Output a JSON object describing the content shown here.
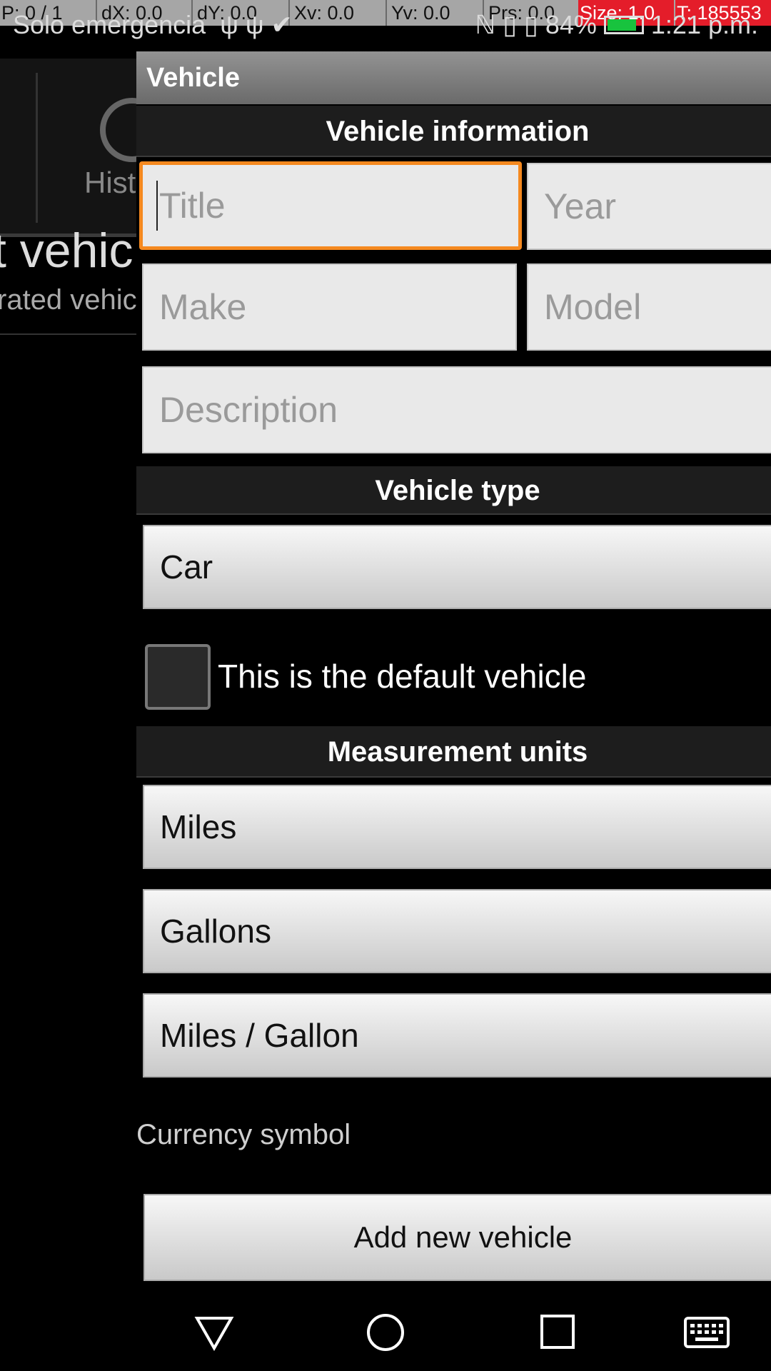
{
  "debug": {
    "p": "P: 0 / 1",
    "dx": "dX: 0.0",
    "dy": "dY: 0.0",
    "xv": "Xv: 0.0",
    "yv": "Yv: 0.0",
    "prs": "Prs: 0.0",
    "size": "Size: 1.0",
    "t": "T: 185553"
  },
  "status_bar": {
    "carrier": "Solo emergencia",
    "battery": "84%",
    "time": "1:21 p.m."
  },
  "background_app": {
    "tab_label": "Hist",
    "title": "t vehicl",
    "subtitle": "rated vehic"
  },
  "dialog": {
    "title": "Vehicle",
    "section_info": "Vehicle information",
    "fields": {
      "title_placeholder": "Title",
      "year_placeholder": "Year",
      "make_placeholder": "Make",
      "model_placeholder": "Model",
      "description_placeholder": "Description"
    },
    "section_type": "Vehicle type",
    "vehicle_type": "Car",
    "default_checkbox_label": "This is the default vehicle",
    "default_checked": false,
    "section_units": "Measurement units",
    "distance_unit": "Miles",
    "volume_unit": "Gallons",
    "economy_unit": "Miles / Gallon",
    "currency_label": "Currency symbol",
    "add_button": "Add new vehicle"
  },
  "accent_color": "#f5891f"
}
